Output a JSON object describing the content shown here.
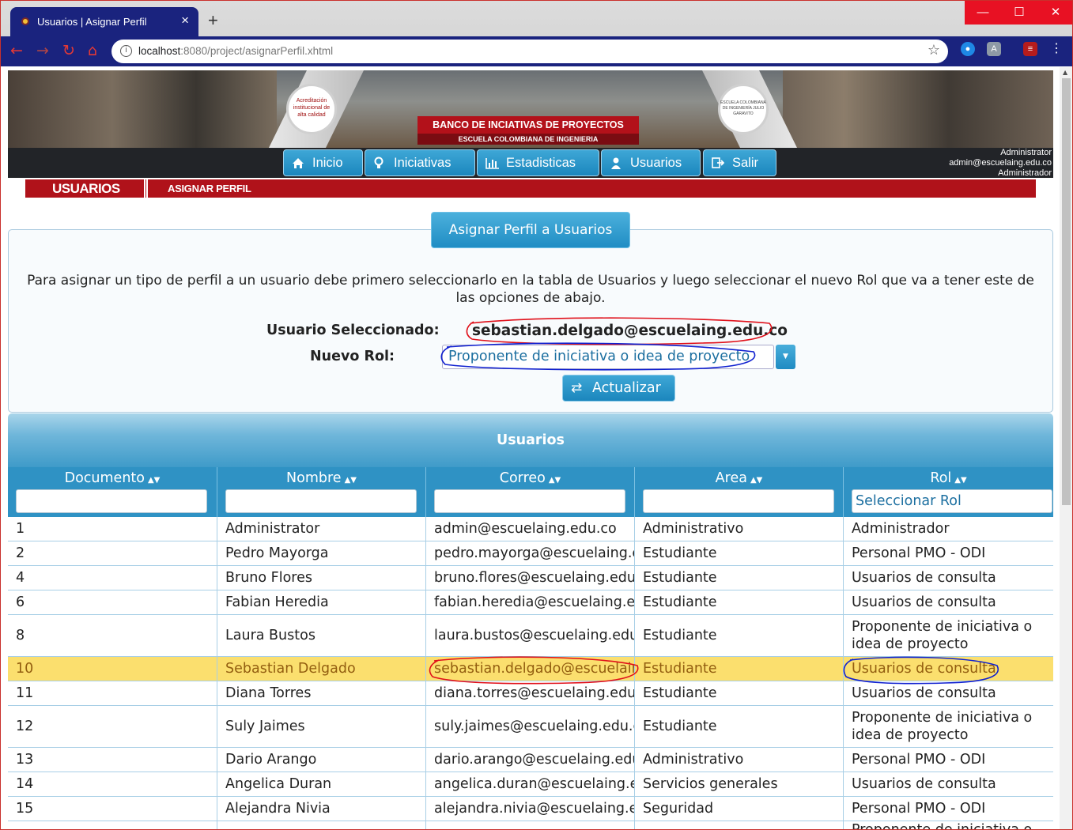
{
  "browser": {
    "tab_title": "Usuarios | Asignar Perfil",
    "url_host": "localhost",
    "url_rest": ":8080/project/asignarPerfil.xhtml",
    "win_min": "—",
    "win_max": "☐",
    "win_close": "✕",
    "tab_close": "×",
    "new_tab": "+"
  },
  "banner": {
    "seal_left": "Acreditación institucional de alta calidad",
    "seal_right": "ESCUELA COLOMBIANA DE INGENIERÍA JULIO GARAVITO",
    "line1": "BANCO DE INCIATIVAS DE PROYECTOS",
    "line2": "ESCUELA COLOMBIANA DE INGENIERIA"
  },
  "menu": {
    "items": [
      {
        "label": "Inicio",
        "icon": "home-icon"
      },
      {
        "label": "Iniciativas",
        "icon": "lightbulb-icon"
      },
      {
        "label": "Estadisticas",
        "icon": "bar-chart-icon"
      },
      {
        "label": "Usuarios",
        "icon": "user-icon"
      },
      {
        "label": "Salir",
        "icon": "logout-icon"
      }
    ],
    "user_name": "Administrator",
    "user_email": "admin@escuelaing.edu.co",
    "user_role": "Administrador"
  },
  "breadcrumb": {
    "section": "USUARIOS",
    "page": "ASIGNAR PERFIL"
  },
  "panel": {
    "title": "Asignar Perfil a Usuarios",
    "instructions": "Para asignar un tipo de perfil a un usuario debe primero seleccionarlo en la tabla de Usuarios y luego seleccionar el nuevo Rol que va a tener este de las opciones de abajo.",
    "selected_label": "Usuario Seleccionado:",
    "selected_value": "sebastian.delgado@escuelaing.edu.co",
    "role_label": "Nuevo Rol:",
    "role_value": "Proponente de iniciativa o idea de proyecto",
    "update_button": "Actualizar"
  },
  "table": {
    "caption": "Usuarios",
    "columns": [
      "Documento",
      "Nombre",
      "Correo",
      "Area",
      "Rol"
    ],
    "role_filter_placeholder": "Seleccionar Rol",
    "rows": [
      {
        "doc": "1",
        "name": "Administrator",
        "email": "admin@escuelaing.edu.co",
        "area": "Administrativo",
        "role": "Administrador"
      },
      {
        "doc": "2",
        "name": "Pedro Mayorga",
        "email": "pedro.mayorga@escuelaing.edu.co",
        "area": "Estudiante",
        "role": "Personal PMO - ODI"
      },
      {
        "doc": "4",
        "name": "Bruno Flores",
        "email": "bruno.flores@escuelaing.edu.co",
        "area": "Estudiante",
        "role": "Usuarios de consulta"
      },
      {
        "doc": "6",
        "name": "Fabian Heredia",
        "email": "fabian.heredia@escuelaing.edu.co",
        "area": "Estudiante",
        "role": "Usuarios de consulta"
      },
      {
        "doc": "8",
        "name": "Laura Bustos",
        "email": "laura.bustos@escuelaing.edu.co",
        "area": "Estudiante",
        "role": "Proponente de iniciativa o idea de proyecto"
      },
      {
        "doc": "10",
        "name": "Sebastian Delgado",
        "email": "sebastian.delgado@escuelaing.edu.co",
        "area": "Estudiante",
        "role": "Usuarios de consulta"
      },
      {
        "doc": "11",
        "name": "Diana Torres",
        "email": "diana.torres@escuelaing.edu.co",
        "area": "Estudiante",
        "role": "Usuarios de consulta"
      },
      {
        "doc": "12",
        "name": "Suly Jaimes",
        "email": "suly.jaimes@escuelaing.edu.co",
        "area": "Estudiante",
        "role": "Proponente de iniciativa o idea de proyecto"
      },
      {
        "doc": "13",
        "name": "Dario Arango",
        "email": "dario.arango@escuelaing.edu.co",
        "area": "Administrativo",
        "role": "Personal PMO - ODI"
      },
      {
        "doc": "14",
        "name": "Angelica Duran",
        "email": "angelica.duran@escuelaing.edu.co",
        "area": "Servicios generales",
        "role": "Usuarios de consulta"
      },
      {
        "doc": "15",
        "name": "Alejandra Nivia",
        "email": "alejandra.nivia@escuelaing.edu.co",
        "area": "Seguridad",
        "role": "Personal PMO - ODI"
      },
      {
        "doc": "",
        "name": "",
        "email": "",
        "area": "",
        "role": "Proponente de iniciativa o idea de proyecto"
      }
    ],
    "selected_row": 5
  }
}
